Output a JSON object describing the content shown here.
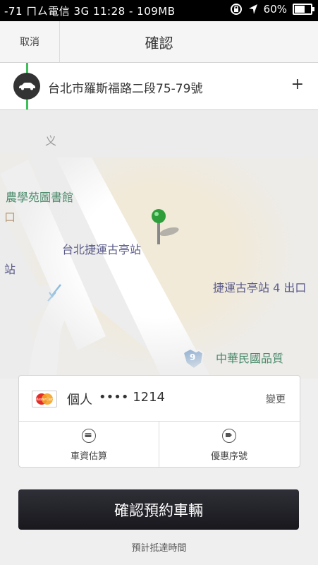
{
  "status_bar": {
    "left_text": "-71 ㄇㄙ電信  3G    11:28 - 109MB",
    "battery": "60%",
    "battery_level": 0.6
  },
  "nav": {
    "cancel_label": "取消",
    "title": "確認"
  },
  "pickup": {
    "address": "台北市羅斯福路二段75-79號",
    "add_label": "+"
  },
  "map": {
    "labels": {
      "library": "農學苑圖書館",
      "station": "台北捷運古亭站",
      "exit": "捷運古亭站 4 出口",
      "school": "中華民國品質",
      "left_fragment_1": "口",
      "left_fragment_2": "站",
      "top_fragment": "义"
    },
    "route_badge": "9"
  },
  "payment": {
    "card_brand": "MasterCard",
    "profile": "個人",
    "card_number": "•••• 1214",
    "change_label": "變更",
    "fare_estimate_label": "車資估算",
    "promo_label": "優惠序號"
  },
  "confirm_button": "確認預約車輛",
  "eta_label": "預計抵達時間",
  "colors": {
    "accent_green": "#3fbf5a",
    "button_dark": "#1f1f26",
    "map_block": "#f1ead9",
    "map_label": "#4a8a6a",
    "station_label": "#5a5a8a"
  }
}
